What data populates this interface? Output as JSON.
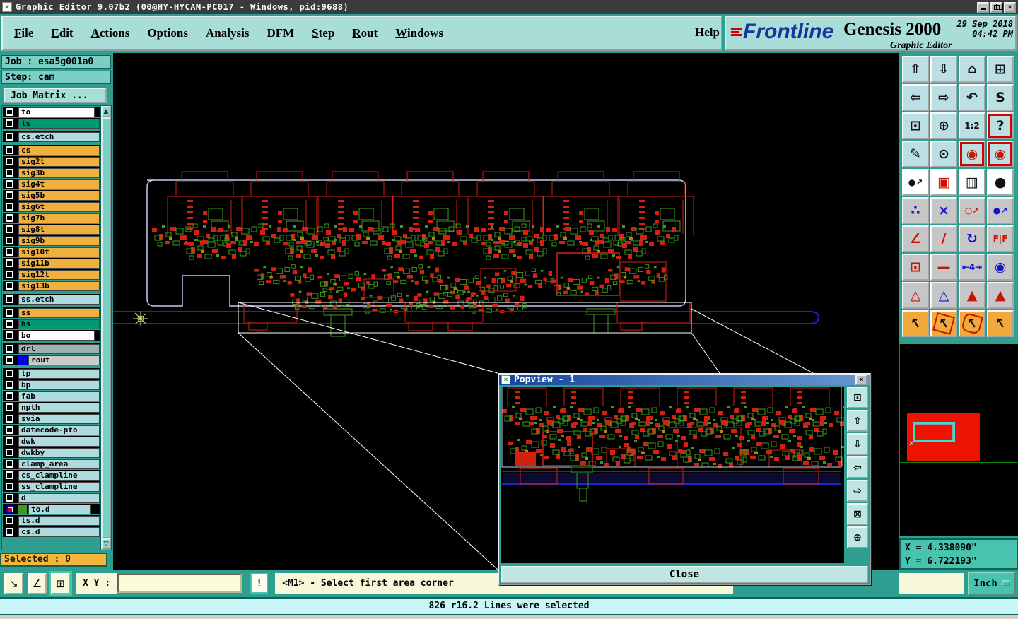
{
  "window": {
    "title": "Graphic Editor 9.07b2 (00@HY-HYCAM-PC017 - Windows, pid:9688)"
  },
  "icons": {
    "app_x": "×",
    "close_x": "×",
    "scroll_up": "▲",
    "scroll_down": "▽"
  },
  "menu": {
    "items": [
      {
        "f": "F",
        "rest": "ile",
        "u": "u"
      },
      {
        "f": "E",
        "rest": "dit",
        "u": "u"
      },
      {
        "f": "A",
        "rest": "ctions",
        "u": "u"
      },
      {
        "f": "O",
        "rest": "ptions",
        "u": ""
      },
      {
        "f": "A",
        "rest": "nalysis",
        "u": ""
      },
      {
        "f": "D",
        "rest": "FM",
        "u": ""
      },
      {
        "f": "S",
        "rest": "tep",
        "u": "u"
      },
      {
        "f": "R",
        "rest": "out",
        "u": "u"
      },
      {
        "f": "W",
        "rest": "indows",
        "u": "u"
      }
    ],
    "help": "Help"
  },
  "brand": {
    "logo_text": "Frontline",
    "product": "Genesis 2000",
    "date": "29 Sep 2018",
    "time": "04:42 PM",
    "subtitle": "Graphic Editor"
  },
  "job_panel": {
    "job_label": "Job : esa5g001a0",
    "step_label": "Step: cam",
    "matrix_button": "Job Matrix ..."
  },
  "layers": [
    {
      "name": "to",
      "bg": "#FFFFFF",
      "arrow": "▼",
      "gap": ""
    },
    {
      "name": "ts",
      "bg": "#009872",
      "gap": ""
    },
    {
      "name": "cs.etch",
      "bg": "#AFDBDE",
      "gap": "gap"
    },
    {
      "name": "cs",
      "bg": "#F0B040",
      "gap": "gap"
    },
    {
      "name": "sig2t",
      "bg": "#F0B040",
      "gap": ""
    },
    {
      "name": "sig3b",
      "bg": "#F0B040",
      "gap": ""
    },
    {
      "name": "sig4t",
      "bg": "#F0B040",
      "gap": ""
    },
    {
      "name": "sig5b",
      "bg": "#F0B040",
      "gap": ""
    },
    {
      "name": "sig6t",
      "bg": "#F0B040",
      "gap": ""
    },
    {
      "name": "sig7b",
      "bg": "#F0B040",
      "gap": ""
    },
    {
      "name": "sig8t",
      "bg": "#F0B040",
      "gap": ""
    },
    {
      "name": "sig9b",
      "bg": "#F0B040",
      "gap": ""
    },
    {
      "name": "sig10t",
      "bg": "#F0B040",
      "gap": ""
    },
    {
      "name": "sig11b",
      "bg": "#F0B040",
      "gap": ""
    },
    {
      "name": "sig12t",
      "bg": "#F0B040",
      "gap": ""
    },
    {
      "name": "sig13b",
      "bg": "#F0B040",
      "gap": ""
    },
    {
      "name": "ss.etch",
      "bg": "#AFDBDE",
      "gap": "gap"
    },
    {
      "name": "ss",
      "bg": "#F0B040",
      "gap": "gap"
    },
    {
      "name": "bs",
      "bg": "#009872",
      "gap": ""
    },
    {
      "name": "bo",
      "bg": "#FFFFFF",
      "arrow": "▼",
      "gap": ""
    },
    {
      "name": "drl",
      "bg": "#9FAFB2",
      "gap": "gap"
    },
    {
      "name": "rout",
      "bg": "#C9CDC9",
      "chip": "#0000EE",
      "gap": ""
    },
    {
      "name": "tp",
      "bg": "#AFDBDE",
      "gap": "gap"
    },
    {
      "name": "bp",
      "bg": "#AFDBDE",
      "gap": ""
    },
    {
      "name": "fab",
      "bg": "#AFDBDE",
      "gap": ""
    },
    {
      "name": "npth",
      "bg": "#AFDBDE",
      "gap": ""
    },
    {
      "name": "svia",
      "bg": "#AFDBDE",
      "gap": ""
    },
    {
      "name": "datecode-pto",
      "bg": "#AFDBDE",
      "gap": ""
    },
    {
      "name": "dwk",
      "bg": "#AFDBDE",
      "gap": ""
    },
    {
      "name": "dwkby",
      "bg": "#AFDBDE",
      "gap": ""
    },
    {
      "name": "clamp_area",
      "bg": "#AFDBDE",
      "gap": ""
    },
    {
      "name": "cs_clampline",
      "bg": "#AFDBDE",
      "gap": ""
    },
    {
      "name": "ss_clampline",
      "bg": "#AFDBDE",
      "gap": ""
    },
    {
      "name": "d",
      "bg": "#AFDBDE",
      "gap": ""
    },
    {
      "name": "to.d",
      "bg": "#AFDBDE",
      "chip": "#3F9B1E",
      "chk": "chk-act",
      "arrow": "▼⊞",
      "gap": ""
    },
    {
      "name": "ts.d",
      "bg": "#AFDBDE",
      "gap": ""
    },
    {
      "name": "cs.d",
      "bg": "#AFDBDE",
      "gap": ""
    }
  ],
  "selected_label": "Selected : 0",
  "right_toolbar": {
    "buttons": [
      {
        "name": "zoom-out-button",
        "glyph": "⇧",
        "cls": "tb-blue"
      },
      {
        "name": "zoom-in-button",
        "glyph": "⇩",
        "cls": "tb-blue"
      },
      {
        "name": "home-view-button",
        "glyph": "⌂",
        "cls": "tb-blue"
      },
      {
        "name": "split-window-xy-button",
        "glyph": "⊞",
        "cls": "tb-blue"
      },
      {
        "name": "pan-left-button",
        "glyph": "⇦",
        "cls": "tb-blue"
      },
      {
        "name": "pan-right-button",
        "glyph": "⇨",
        "cls": "tb-blue"
      },
      {
        "name": "previous-view-button",
        "glyph": "↶",
        "cls": "tb-blue"
      },
      {
        "name": "serpentine-view-button",
        "glyph": "S",
        "cls": "tb-blue"
      },
      {
        "name": "fit-window-button",
        "glyph": "⊡",
        "cls": "tb-blue"
      },
      {
        "name": "center-view-button",
        "glyph": "⊕",
        "cls": "tb-blue"
      },
      {
        "name": "scale-1-2-button",
        "glyph": "1:2",
        "cls": "tb-blue sm"
      },
      {
        "name": "help-query-button",
        "glyph": "?",
        "cls": "tb-blue tb-hl"
      },
      {
        "name": "setup-tools-button",
        "glyph": "✎",
        "cls": "tb-blue"
      },
      {
        "name": "zoom-target-button",
        "glyph": "⊙",
        "cls": "tb-blue"
      },
      {
        "name": "display-profile-1-button",
        "glyph": "◉",
        "cls": "tb-blue tb-hl ic-red"
      },
      {
        "name": "display-profile-2-button",
        "glyph": "◉",
        "cls": "tb-blue tb-hl ic-red"
      },
      {
        "name": "select-symbol-button",
        "glyph": "●↗",
        "cls": "tb-white sm"
      },
      {
        "name": "edit-symbol-button",
        "glyph": "▣",
        "cls": "tb-white ic-red"
      },
      {
        "name": "measure-ruler-button",
        "glyph": "▥",
        "cls": "tb-white"
      },
      {
        "name": "pad-symbol-button",
        "glyph": "●",
        "cls": "tb-white"
      },
      {
        "name": "net-connect-button",
        "glyph": "∴",
        "cls": "tb-gray ic-blue"
      },
      {
        "name": "delete-object-button",
        "glyph": "×",
        "cls": "tb-gray ic-blue"
      },
      {
        "name": "copy-object-button",
        "glyph": "○↗",
        "cls": "tb-gray ic-red sm"
      },
      {
        "name": "move-object-button",
        "glyph": "●↗",
        "cls": "tb-gray ic-blue sm"
      },
      {
        "name": "construct-angle-button",
        "glyph": "∠",
        "cls": "tb-gray ic-red"
      },
      {
        "name": "slant-line-button",
        "glyph": "∕",
        "cls": "tb-gray ic-red"
      },
      {
        "name": "rotate-object-button",
        "glyph": "↻",
        "cls": "tb-gray ic-blue"
      },
      {
        "name": "mirror-object-button",
        "glyph": "F|F",
        "cls": "tb-gray ic-red sm"
      },
      {
        "name": "resize-symbol-button",
        "glyph": "⊡",
        "cls": "tb-gray ic-red"
      },
      {
        "name": "stretch-line-button",
        "glyph": "—",
        "cls": "tb-gray ic-red"
      },
      {
        "name": "measure-gap-button",
        "glyph": "⇤4⇥",
        "cls": "tb-gray ic-blue sm"
      },
      {
        "name": "merge-surfaces-button",
        "glyph": "◉",
        "cls": "tb-gray ic-blue"
      },
      {
        "name": "triangle-tool-1-button",
        "glyph": "△",
        "cls": "tb-gray ic-red"
      },
      {
        "name": "triangle-tool-2-button",
        "glyph": "△",
        "cls": "tb-gray ic-blue"
      },
      {
        "name": "triangle-tool-3-button",
        "glyph": "▲",
        "cls": "tb-gray ic-red"
      },
      {
        "name": "triangle-tool-4-button",
        "glyph": "▲",
        "cls": "tb-gray ic-red"
      },
      {
        "name": "select-single-button",
        "glyph": "↖",
        "cls": "tb-orange ar"
      },
      {
        "name": "select-frame-button",
        "glyph": "↖",
        "cls": "tb-orange ar fr"
      },
      {
        "name": "select-polygon-button",
        "glyph": "↖",
        "cls": "tb-orange ar fr2"
      },
      {
        "name": "select-net-button",
        "glyph": "↖",
        "cls": "tb-orange ar"
      }
    ]
  },
  "coords": {
    "x": "X = 4.338090\"",
    "y": "Y = 6.722193\"",
    "units": "Inch"
  },
  "command_bar": {
    "buttons": [
      {
        "name": "measure-distance-button",
        "glyph": "↘",
        "cls": ""
      },
      {
        "name": "measure-angle-button",
        "glyph": "∠",
        "cls": ""
      },
      {
        "name": "grid-window-button",
        "glyph": "⊞",
        "cls": "active"
      }
    ],
    "xy_label": "X Y :",
    "xy_value": "",
    "alert_label": "!",
    "prompt": "<M1> - Select first area corner"
  },
  "status_bar": {
    "message": "826 r16.2 Lines were selected"
  },
  "popview": {
    "title": "Popview - 1",
    "close_button": "Close",
    "buttons": [
      {
        "name": "popview-clone-button",
        "glyph": "⊡"
      },
      {
        "name": "popview-zoom-out-button",
        "glyph": "⇧"
      },
      {
        "name": "popview-zoom-in-button",
        "glyph": "⇩"
      },
      {
        "name": "popview-pan-left-button",
        "glyph": "⇦"
      },
      {
        "name": "popview-pan-right-button",
        "glyph": "⇨"
      },
      {
        "name": "popview-fit-in-button",
        "glyph": "⊠"
      },
      {
        "name": "popview-fit-out-button",
        "glyph": "⊕"
      }
    ]
  },
  "colors": {
    "frame_teal": "#2E9E90",
    "menu_bg": "#A9DDD7",
    "panel_light": "#7CCFC5",
    "layer_orange": "#F0B040",
    "layer_green": "#009872",
    "layer_pale": "#AFDBDE",
    "selected_bg": "#F5B63E",
    "cream": "#F7F7D9",
    "status_cyan": "#C9F7F7",
    "coord_teal": "#49C3AD",
    "pcb_red": "#D22110",
    "pcb_green": "#3F9B1E",
    "pcb_blue": "#2222CC",
    "board_outline": "#C8C8F2",
    "popview_titlebar": "#16459C"
  }
}
